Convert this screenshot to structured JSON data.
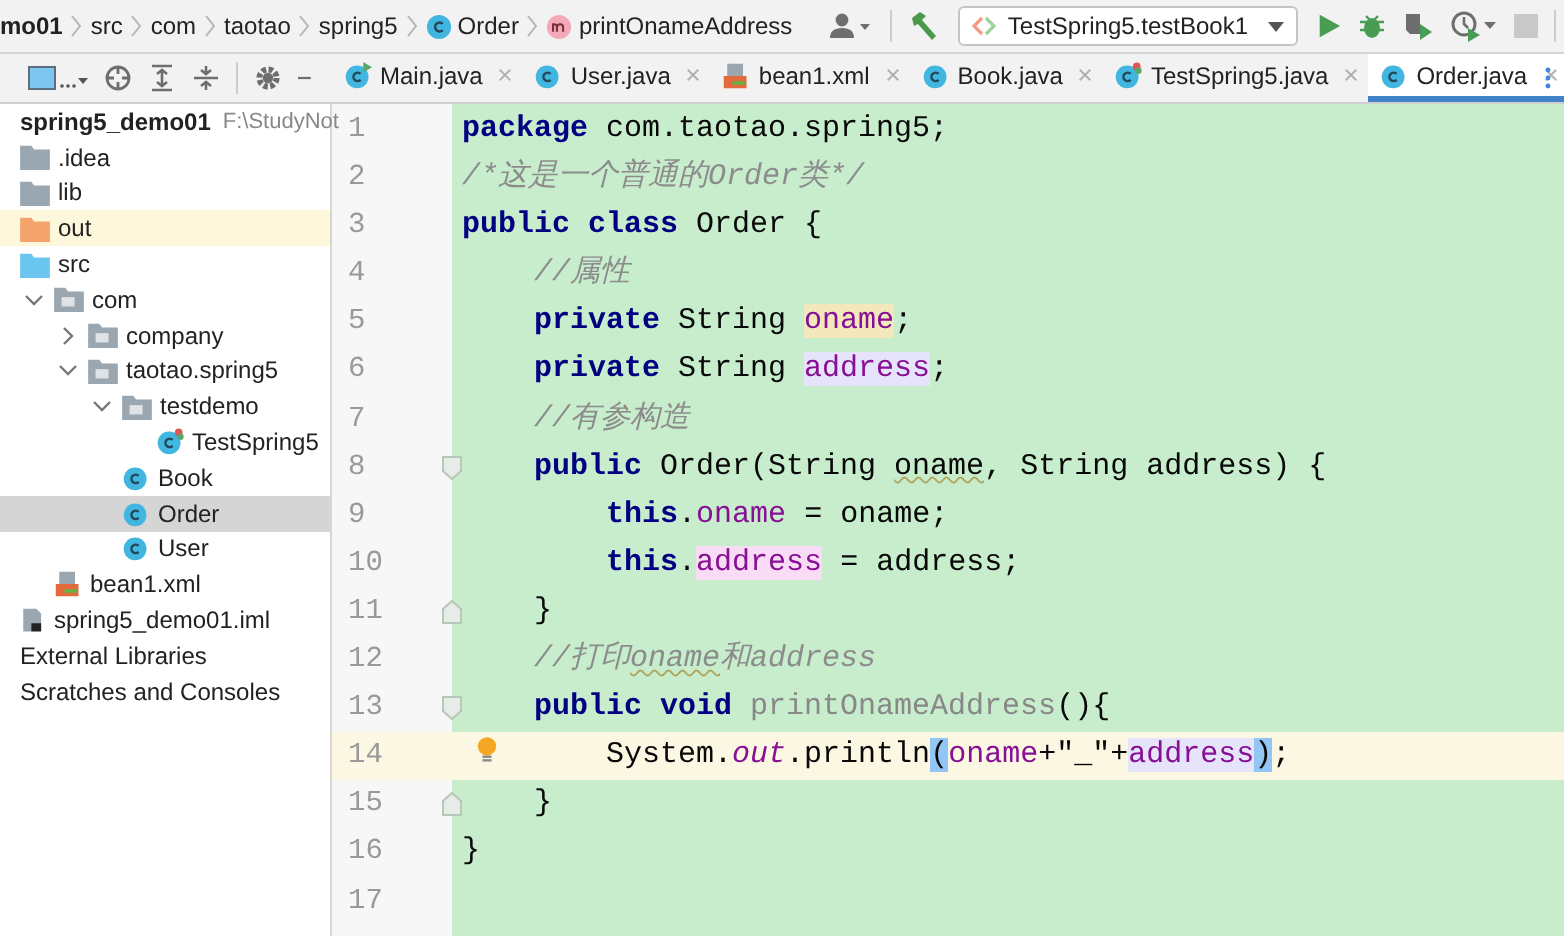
{
  "breadcrumb": [
    {
      "label": "mo01",
      "kind": "module"
    },
    {
      "label": "src",
      "kind": "dir"
    },
    {
      "label": "com",
      "kind": "dir"
    },
    {
      "label": "taotao",
      "kind": "dir"
    },
    {
      "label": "spring5",
      "kind": "dir"
    },
    {
      "label": "Order",
      "kind": "class"
    },
    {
      "label": "printOnameAddress",
      "kind": "method"
    }
  ],
  "run_config": {
    "label": "TestSpring5.testBook1"
  },
  "tabs": [
    {
      "label": "Main.java",
      "kind": "runnable",
      "selected": false
    },
    {
      "label": "User.java",
      "kind": "class",
      "selected": false
    },
    {
      "label": "bean1.xml",
      "kind": "xml",
      "selected": false
    },
    {
      "label": "Book.java",
      "kind": "class",
      "selected": false
    },
    {
      "label": "TestSpring5.java",
      "kind": "test",
      "selected": false
    },
    {
      "label": "Order.java",
      "kind": "class",
      "selected": true
    }
  ],
  "project_tree": [
    {
      "label": "spring5_demo01",
      "path": "F:\\StudyNot",
      "kind": "project",
      "selected": false
    },
    {
      "label": ".idea",
      "kind": "folder",
      "selected": false
    },
    {
      "label": "lib",
      "kind": "folder",
      "selected": false
    },
    {
      "label": "out",
      "kind": "excluded",
      "selected": false
    },
    {
      "label": "src",
      "kind": "source",
      "selected": false,
      "children": [
        {
          "label": "com",
          "kind": "package",
          "expanded": true,
          "selected": false,
          "children": [
            {
              "label": "company",
              "kind": "package",
              "expanded": false,
              "selected": false
            },
            {
              "label": "taotao.spring5",
              "kind": "package",
              "expanded": true,
              "selected": false,
              "children": [
                {
                  "label": "testdemo",
                  "kind": "package",
                  "expanded": true,
                  "selected": false,
                  "children": [
                    {
                      "label": "TestSpring5",
                      "kind": "test",
                      "selected": false
                    }
                  ]
                },
                {
                  "label": "Book",
                  "kind": "class",
                  "selected": false
                },
                {
                  "label": "Order",
                  "kind": "class",
                  "selected": true
                },
                {
                  "label": "User",
                  "kind": "class",
                  "selected": false
                }
              ]
            }
          ]
        },
        {
          "label": "bean1.xml",
          "kind": "xml",
          "selected": false
        }
      ]
    },
    {
      "label": "spring5_demo01.iml",
      "kind": "iml",
      "selected": false
    },
    {
      "label": "External Libraries",
      "kind": "group",
      "selected": false
    },
    {
      "label": "Scratches and Consoles",
      "kind": "group",
      "selected": false
    }
  ],
  "editor": {
    "lines": [
      {
        "number": "1",
        "kind": "plain",
        "current": false,
        "tokens": [
          {
            "text": "package",
            "kind": "kw"
          },
          {
            "text": " com.taotao.spring5;",
            "kind": "plain"
          }
        ]
      },
      {
        "number": "2",
        "kind": "plain",
        "current": false,
        "tokens": [
          {
            "text": "/*这是一个普通的Order类*/",
            "kind": "comment"
          }
        ]
      },
      {
        "number": "3",
        "kind": "plain",
        "current": false,
        "tokens": [
          {
            "text": "public class",
            "kind": "kw"
          },
          {
            "text": " Order {",
            "kind": "plain"
          }
        ]
      },
      {
        "number": "4",
        "kind": "plain",
        "current": false,
        "tokens": [
          {
            "text": "    //属性",
            "kind": "comment"
          }
        ]
      },
      {
        "number": "5",
        "kind": "plain",
        "current": false,
        "tokens": [
          {
            "text": "    private",
            "kind": "kw"
          },
          {
            "text": " String ",
            "kind": "plain"
          },
          {
            "text": "oname",
            "kind": "field-unused"
          },
          {
            "text": ";",
            "kind": "plain"
          }
        ]
      },
      {
        "number": "6",
        "kind": "plain",
        "current": false,
        "tokens": [
          {
            "text": "    private",
            "kind": "kw"
          },
          {
            "text": " String ",
            "kind": "plain"
          },
          {
            "text": "address",
            "kind": "field-read"
          },
          {
            "text": ";",
            "kind": "plain"
          }
        ]
      },
      {
        "number": "7",
        "kind": "plain",
        "current": false,
        "tokens": [
          {
            "text": "    //有参构造",
            "kind": "comment"
          }
        ]
      },
      {
        "number": "8",
        "kind": "fold-start",
        "current": false,
        "tokens": [
          {
            "text": "    public",
            "kind": "kw"
          },
          {
            "text": " Order(String ",
            "kind": "plain"
          },
          {
            "text": "oname",
            "kind": "misspelled"
          },
          {
            "text": ", String address) {",
            "kind": "plain"
          }
        ]
      },
      {
        "number": "9",
        "kind": "plain",
        "current": false,
        "tokens": [
          {
            "text": "        this",
            "kind": "kw"
          },
          {
            "text": ".",
            "kind": "plain"
          },
          {
            "text": "oname",
            "kind": "field"
          },
          {
            "text": " = oname;",
            "kind": "plain"
          }
        ]
      },
      {
        "number": "10",
        "kind": "plain",
        "current": false,
        "tokens": [
          {
            "text": "        this",
            "kind": "kw"
          },
          {
            "text": ".",
            "kind": "plain"
          },
          {
            "text": "address",
            "kind": "field-write"
          },
          {
            "text": " = address;",
            "kind": "plain"
          }
        ]
      },
      {
        "number": "11",
        "kind": "fold-end",
        "current": false,
        "tokens": [
          {
            "text": "    }",
            "kind": "plain"
          }
        ]
      },
      {
        "number": "12",
        "kind": "plain",
        "current": false,
        "tokens": [
          {
            "text": "    //打印",
            "kind": "comment"
          },
          {
            "text": "oname",
            "kind": "comment-misspelled"
          },
          {
            "text": "和address",
            "kind": "comment"
          }
        ]
      },
      {
        "number": "13",
        "kind": "fold-start",
        "current": false,
        "tokens": [
          {
            "text": "    public void ",
            "kind": "kw"
          },
          {
            "text": "printOnameAddress",
            "kind": "unused"
          },
          {
            "text": "(){",
            "kind": "plain"
          }
        ]
      },
      {
        "number": "14",
        "kind": "plain",
        "current": true,
        "tokens": [
          {
            "text": "        System.",
            "kind": "plain"
          },
          {
            "text": "out",
            "kind": "static"
          },
          {
            "text": ".println",
            "kind": "plain"
          },
          {
            "text": "(",
            "kind": "brace"
          },
          {
            "text": "oname",
            "kind": "field"
          },
          {
            "text": "+\"_\"+",
            "kind": "plain"
          },
          {
            "text": "address",
            "kind": "field-read"
          },
          {
            "text": ")",
            "kind": "brace"
          },
          {
            "text": ";",
            "kind": "plain"
          }
        ]
      },
      {
        "number": "15",
        "kind": "fold-end",
        "current": false,
        "tokens": [
          {
            "text": "    }",
            "kind": "plain"
          }
        ]
      },
      {
        "number": "16",
        "kind": "plain",
        "current": false,
        "tokens": [
          {
            "text": "}",
            "kind": "plain"
          }
        ]
      },
      {
        "number": "17",
        "kind": "plain",
        "current": false
      }
    ]
  }
}
